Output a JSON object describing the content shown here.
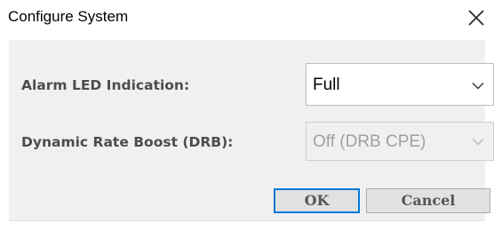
{
  "dialog": {
    "title": "Configure System",
    "close_icon": "close-icon"
  },
  "fields": {
    "alarm_led": {
      "label": "Alarm LED Indication:",
      "value": "Full",
      "enabled": true
    },
    "drb": {
      "label": "Dynamic Rate Boost (DRB):",
      "value": "Off (DRB CPE)",
      "enabled": false
    }
  },
  "buttons": {
    "ok_label": "OK",
    "cancel_label": "Cancel"
  },
  "colors": {
    "panel_bg": "#f0f0f0",
    "label_text": "#4d4d4d",
    "disabled_text": "#a0a0a0",
    "default_button_border": "#0078d7",
    "button_bg": "#e1e1e1"
  }
}
